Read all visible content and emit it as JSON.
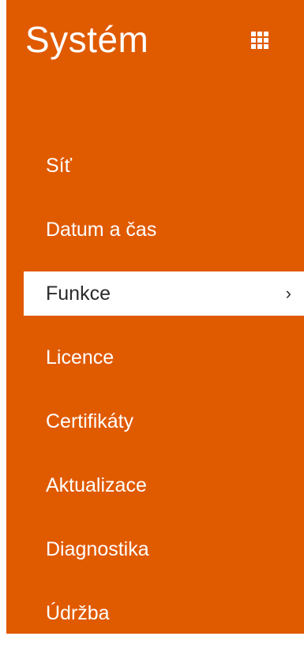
{
  "sidebar": {
    "title": "Systém",
    "accent_color": "#E05A00",
    "apps_icon": "grid-icon",
    "items": [
      {
        "label": "Síť",
        "active": false
      },
      {
        "label": "Datum a čas",
        "active": false
      },
      {
        "label": "Funkce",
        "active": true,
        "indicator": "›"
      },
      {
        "label": "Licence",
        "active": false
      },
      {
        "label": "Certifikáty",
        "active": false
      },
      {
        "label": "Aktualizace",
        "active": false
      },
      {
        "label": "Diagnostika",
        "active": false
      },
      {
        "label": "Údržba",
        "active": false
      }
    ]
  }
}
